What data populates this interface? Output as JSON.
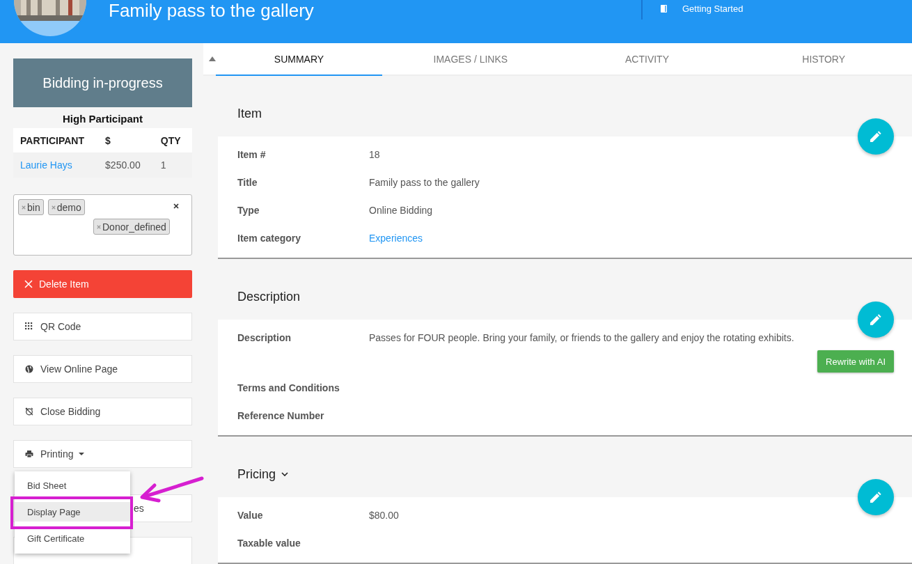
{
  "header": {
    "title": "Family pass to the gallery",
    "link": "Getting Started"
  },
  "sidebar": {
    "status": "Bidding in-progress",
    "high_participant": {
      "title": "High Participant",
      "columns": [
        "PARTICIPANT",
        "$",
        "QTY"
      ],
      "rows": [
        [
          "Laurie Hays",
          "$250.00",
          "1"
        ]
      ]
    },
    "tags": [
      "bin",
      "demo",
      "Donor_defined"
    ],
    "delete_button": "Delete Item",
    "buttons": [
      {
        "label": "QR Code",
        "kind": "qr"
      },
      {
        "label": "View Online Page",
        "kind": "globe"
      },
      {
        "label": "Close Bidding",
        "kind": "alarm"
      },
      {
        "label": "Printing",
        "kind": "printer"
      },
      {
        "label": "es",
        "kind": "covered"
      },
      {
        "kind": "hidden"
      }
    ],
    "printing_menu": [
      {
        "label": "Bid Sheet",
        "selected": false
      },
      {
        "label": "Display Page",
        "selected": true
      },
      {
        "label": "Gift Certificate",
        "selected": false
      }
    ]
  },
  "tabs": [
    {
      "label": "SUMMARY",
      "selected": true
    },
    {
      "label": "IMAGES / LINKS",
      "selected": false
    },
    {
      "label": "ACTIVITY",
      "selected": false
    },
    {
      "label": "HISTORY",
      "selected": false
    }
  ],
  "sections": [
    {
      "title": "Item",
      "expandable": false,
      "fields": [
        {
          "label": "Item #",
          "value": "18",
          "link": false
        },
        {
          "label": "Title",
          "value": "Family pass to the gallery",
          "link": false
        },
        {
          "label": "Type",
          "value": "Online Bidding",
          "link": false
        },
        {
          "label": "Item category",
          "value": "Experiences",
          "link": true
        }
      ]
    },
    {
      "title": "Description",
      "expandable": false,
      "fields": [
        {
          "label": "Description",
          "value": "Passes for FOUR people. Bring your family, or friends to the gallery and enjoy the rotating exhibits.",
          "link": false,
          "action": "Rewrite with AI"
        },
        {
          "label": "Terms and Conditions"
        },
        {
          "label": "Reference Number"
        }
      ]
    },
    {
      "title": "Pricing",
      "expandable": true,
      "fields": [
        {
          "label": "Value",
          "value": "$80.00",
          "link": false
        },
        {
          "label": "Taxable value"
        }
      ]
    }
  ]
}
